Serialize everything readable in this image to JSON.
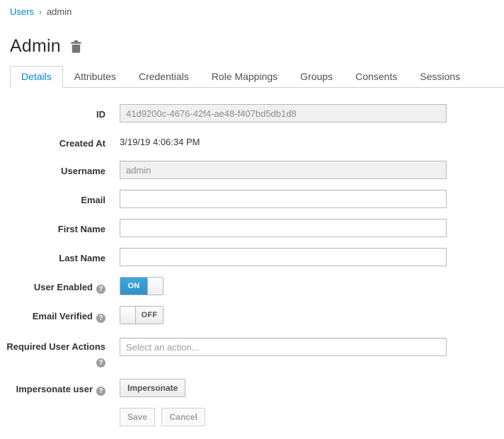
{
  "breadcrumb": {
    "root": "Users",
    "separator": "›",
    "current": "admin"
  },
  "header": {
    "title": "Admin"
  },
  "tabs": [
    {
      "label": "Details",
      "active": true
    },
    {
      "label": "Attributes",
      "active": false
    },
    {
      "label": "Credentials",
      "active": false
    },
    {
      "label": "Role Mappings",
      "active": false
    },
    {
      "label": "Groups",
      "active": false
    },
    {
      "label": "Consents",
      "active": false
    },
    {
      "label": "Sessions",
      "active": false
    }
  ],
  "form": {
    "id": {
      "label": "ID",
      "value": "41d9200c-4676-42f4-ae48-f407bd5db1d8",
      "disabled": true
    },
    "created_at": {
      "label": "Created At",
      "value": "3/19/19 4:06:34 PM"
    },
    "username": {
      "label": "Username",
      "value": "admin",
      "disabled": true
    },
    "email": {
      "label": "Email",
      "value": ""
    },
    "first_name": {
      "label": "First Name",
      "value": ""
    },
    "last_name": {
      "label": "Last Name",
      "value": ""
    },
    "user_enabled": {
      "label": "User Enabled",
      "state": "ON"
    },
    "email_verified": {
      "label": "Email Verified",
      "state": "OFF"
    },
    "required_user_actions": {
      "label": "Required User Actions",
      "placeholder": "Select an action..."
    },
    "impersonate": {
      "label": "Impersonate user",
      "button_label": "Impersonate"
    },
    "actions": {
      "save_label": "Save",
      "cancel_label": "Cancel"
    }
  },
  "icons": {
    "help": "?"
  },
  "colors": {
    "accent": "#0088ce",
    "toggle_on": "#39a5dc",
    "tab_border": "#d1d1d1",
    "disabled_input_bg": "#f0f0f0"
  }
}
